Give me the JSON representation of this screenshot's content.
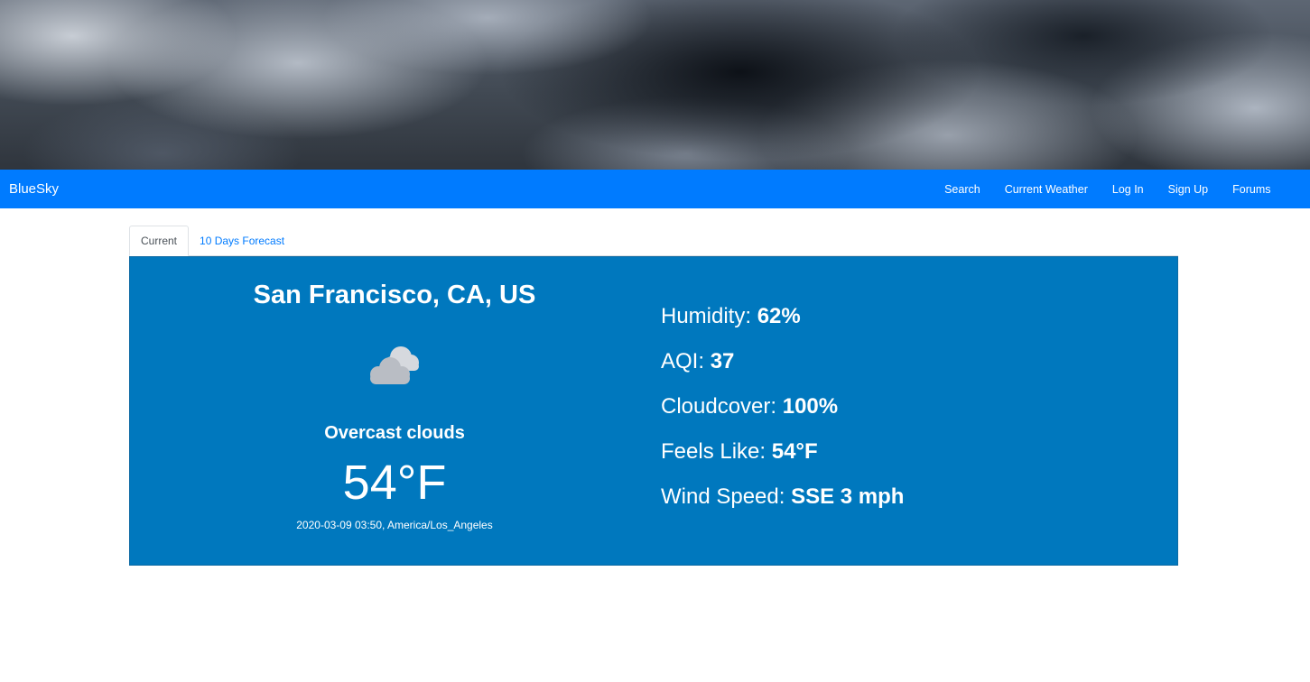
{
  "navbar": {
    "brand": "BlueSky",
    "links": [
      {
        "label": "Search"
      },
      {
        "label": "Current Weather"
      },
      {
        "label": "Log In"
      },
      {
        "label": "Sign Up"
      },
      {
        "label": "Forums"
      }
    ],
    "color": "#007bff"
  },
  "tabs": [
    {
      "label": "Current",
      "active": true
    },
    {
      "label": "10 Days Forecast",
      "active": false
    }
  ],
  "weather": {
    "location": "San Francisco, CA, US",
    "icon": "cloud-icon",
    "condition": "Overcast clouds",
    "temperature": "54°F",
    "datetime": "2020-03-09 03:50, America/Los_Angeles",
    "panel_color": "#0078be",
    "stats": [
      {
        "label": "Humidity: ",
        "value": "62%"
      },
      {
        "label": "AQI: ",
        "value": "37"
      },
      {
        "label": "Cloudcover: ",
        "value": "100%"
      },
      {
        "label": "Feels Like: ",
        "value": "54°F"
      },
      {
        "label": "Wind Speed: ",
        "value": "SSE 3 mph"
      }
    ]
  }
}
